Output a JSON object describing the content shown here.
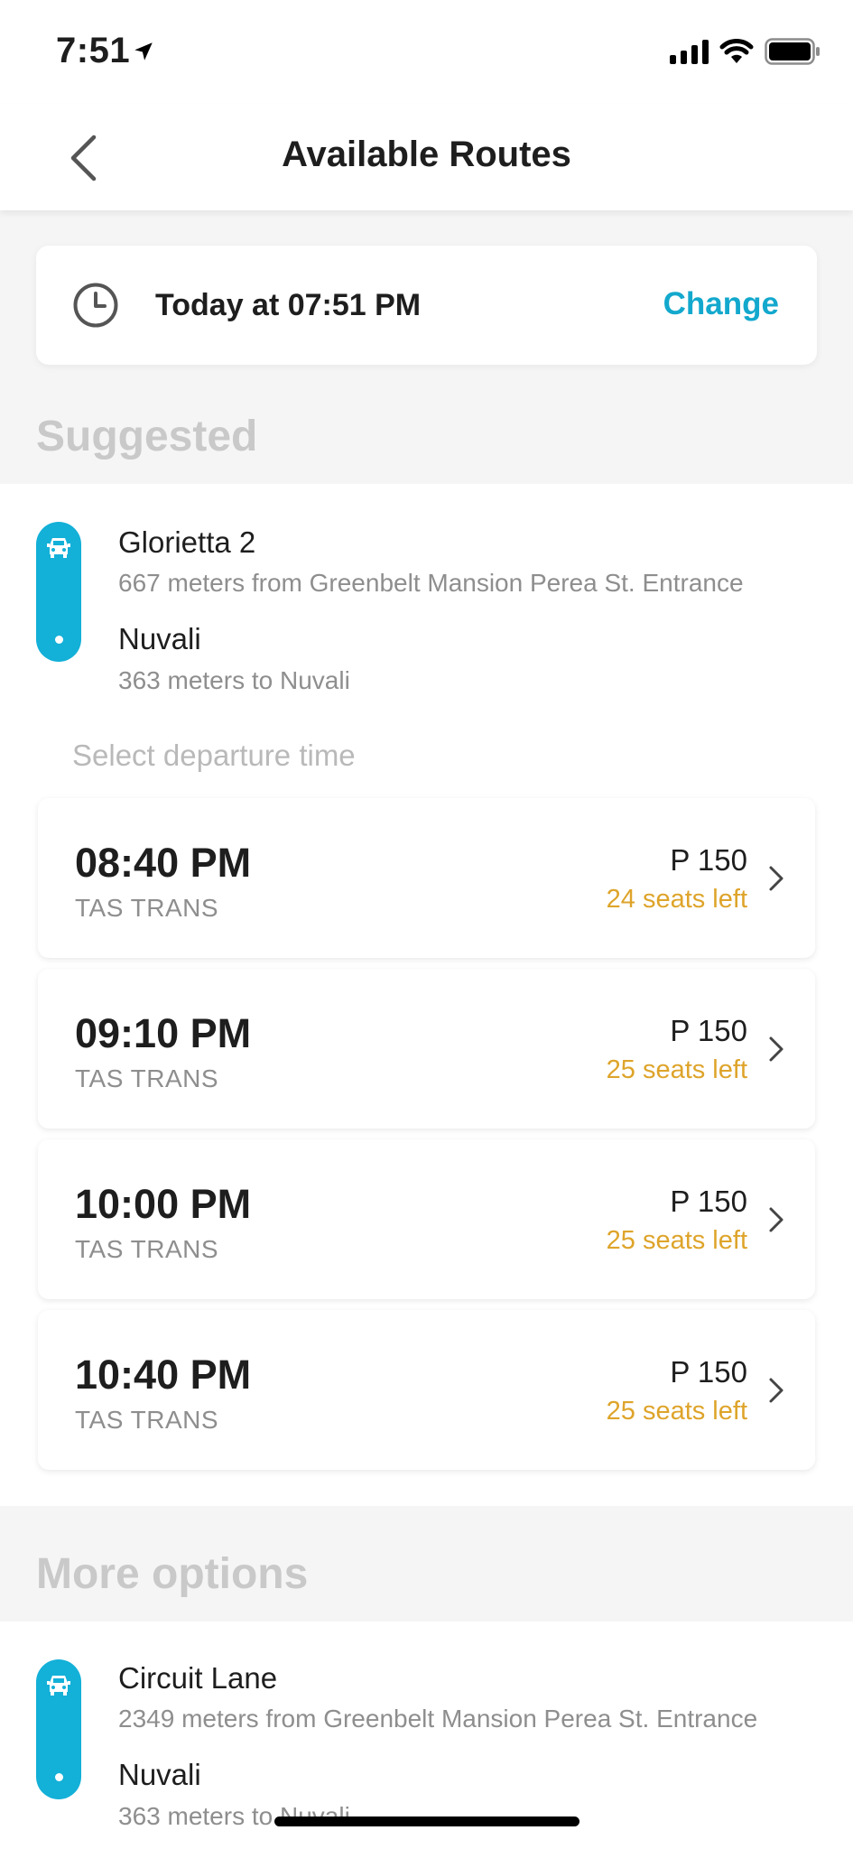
{
  "status": {
    "time": "7:51"
  },
  "header": {
    "title": "Available Routes"
  },
  "schedule": {
    "text": "Today at 07:51 PM",
    "change_label": "Change"
  },
  "suggested": {
    "heading": "Suggested",
    "route": {
      "from_name": "Glorietta 2",
      "from_detail": "667 meters from Greenbelt Mansion Perea St. Entrance",
      "to_name": "Nuvali",
      "to_detail": "363 meters to Nuvali"
    },
    "select_label": "Select departure time",
    "departures": [
      {
        "time": "08:40 PM",
        "operator": "TAS TRANS",
        "price": "P 150",
        "seats": "24 seats left"
      },
      {
        "time": "09:10 PM",
        "operator": "TAS TRANS",
        "price": "P 150",
        "seats": "25 seats left"
      },
      {
        "time": "10:00 PM",
        "operator": "TAS TRANS",
        "price": "P 150",
        "seats": "25 seats left"
      },
      {
        "time": "10:40 PM",
        "operator": "TAS TRANS",
        "price": "P 150",
        "seats": "25 seats left"
      }
    ]
  },
  "more_options": {
    "heading": "More options",
    "route": {
      "from_name": "Circuit Lane",
      "from_detail": "2349 meters from Greenbelt Mansion Perea St. Entrance",
      "to_name": "Nuvali",
      "to_detail": "363 meters to Nuvali"
    }
  },
  "colors": {
    "accent": "#13a8cd",
    "pill": "#13b0d8",
    "seats": "#dea42a"
  }
}
